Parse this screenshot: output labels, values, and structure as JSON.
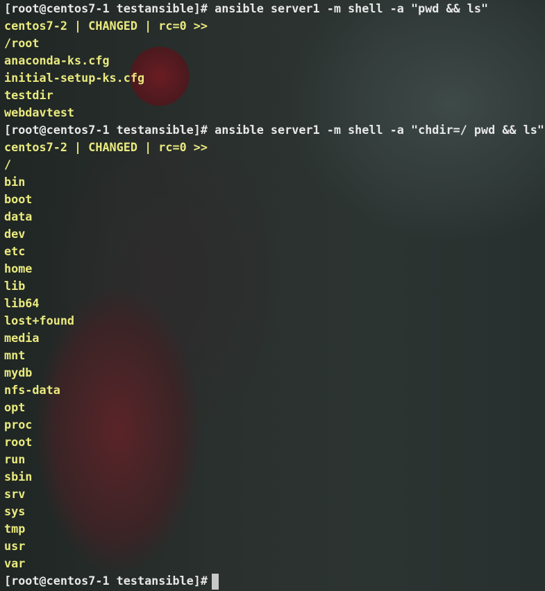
{
  "terminal": {
    "colors": {
      "prompt": "#e8e8e8",
      "output": "#eaea7e"
    },
    "lines": [
      {
        "type": "prompt",
        "text": "[root@centos7-1 testansible]# ansible server1 -m shell -a \"pwd && ls\""
      },
      {
        "type": "out",
        "text": "centos7-2 | CHANGED | rc=0 >>"
      },
      {
        "type": "out",
        "text": "/root"
      },
      {
        "type": "out",
        "text": "anaconda-ks.cfg"
      },
      {
        "type": "out",
        "text": "initial-setup-ks.cfg"
      },
      {
        "type": "out",
        "text": "testdir"
      },
      {
        "type": "out",
        "text": "webdavtest"
      },
      {
        "type": "prompt",
        "text": "[root@centos7-1 testansible]# ansible server1 -m shell -a \"chdir=/ pwd && ls\""
      },
      {
        "type": "out",
        "text": "centos7-2 | CHANGED | rc=0 >>"
      },
      {
        "type": "out",
        "text": "/"
      },
      {
        "type": "out",
        "text": "bin"
      },
      {
        "type": "out",
        "text": "boot"
      },
      {
        "type": "out",
        "text": "data"
      },
      {
        "type": "out",
        "text": "dev"
      },
      {
        "type": "out",
        "text": "etc"
      },
      {
        "type": "out",
        "text": "home"
      },
      {
        "type": "out",
        "text": "lib"
      },
      {
        "type": "out",
        "text": "lib64"
      },
      {
        "type": "out",
        "text": "lost+found"
      },
      {
        "type": "out",
        "text": "media"
      },
      {
        "type": "out",
        "text": "mnt"
      },
      {
        "type": "out",
        "text": "mydb"
      },
      {
        "type": "out",
        "text": "nfs-data"
      },
      {
        "type": "out",
        "text": "opt"
      },
      {
        "type": "out",
        "text": "proc"
      },
      {
        "type": "out",
        "text": "root"
      },
      {
        "type": "out",
        "text": "run"
      },
      {
        "type": "out",
        "text": "sbin"
      },
      {
        "type": "out",
        "text": "srv"
      },
      {
        "type": "out",
        "text": "sys"
      },
      {
        "type": "out",
        "text": "tmp"
      },
      {
        "type": "out",
        "text": "usr"
      },
      {
        "type": "out",
        "text": "var"
      }
    ],
    "current_prompt": "[root@centos7-1 testansible]# "
  }
}
